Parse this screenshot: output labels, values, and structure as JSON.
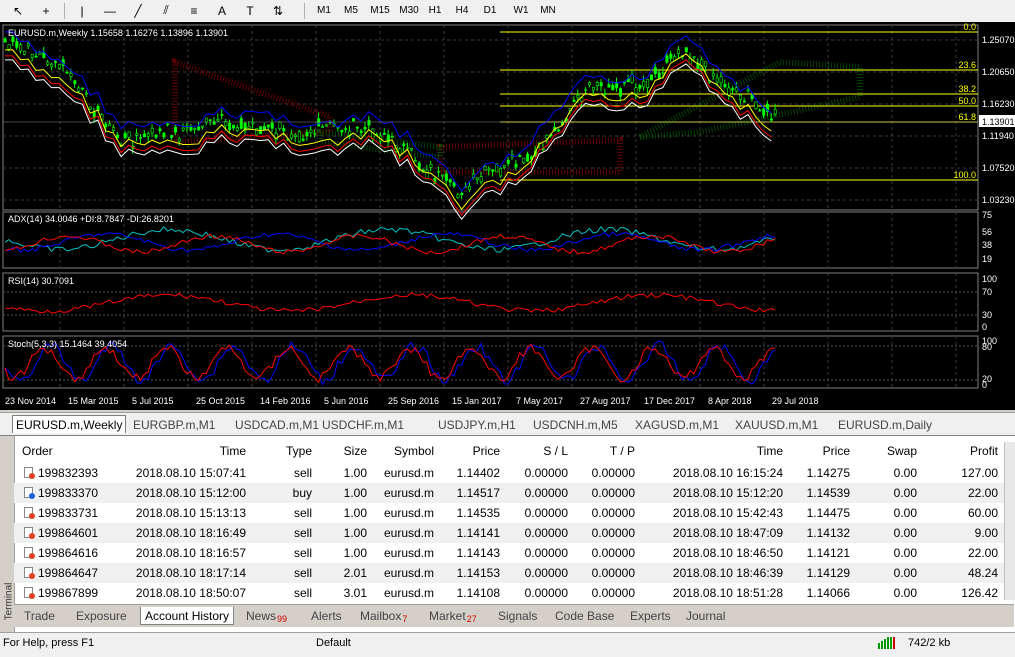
{
  "toolbar": {
    "timeframes": [
      "M1",
      "M5",
      "M15",
      "M30",
      "H1",
      "H4",
      "D1",
      "W1",
      "MN"
    ]
  },
  "chart": {
    "header": "EURUSD.m,Weekly  1.15658 1.16276 1.13896 1.13901",
    "price_labels": [
      "1.25070",
      "1.20650",
      "1.16230",
      "1.13901",
      "1.11940",
      "1.07520",
      "1.03230"
    ],
    "fib_levels": [
      "0.0",
      "23.6",
      "38.2",
      "50.0",
      "61.8",
      "100.0"
    ],
    "adx_label": "ADX(14) 34.0046 +DI:8.7847 -DI:26.8201",
    "adx_scale": [
      "75",
      "56",
      "38",
      "19"
    ],
    "rsi_label": "RSI(14) 30.7091",
    "rsi_scale": [
      "100",
      "70",
      "30",
      "0"
    ],
    "stoch_label": "Stoch(5,3,3) 15.1464 39.4054",
    "stoch_scale": [
      "100",
      "80",
      "20",
      "0"
    ],
    "dates": [
      "23 Nov 2014",
      "15 Mar 2015",
      "5 Jul 2015",
      "25 Oct 2015",
      "14 Feb 2016",
      "5 Jun 2016",
      "25 Sep 2016",
      "15 Jan 2017",
      "7 May 2017",
      "27 Aug 2017",
      "17 Dec 2017",
      "8 Apr 2018",
      "29 Jul 2018"
    ]
  },
  "chart_tabs": [
    "EURUSD.m,Weekly",
    "EURGBP.m,M1",
    "USDCAD.m,M1",
    "USDCHF.m,M1",
    "USDJPY.m,H1",
    "USDCNH.m,M5",
    "XAGUSD.m,M1",
    "XAUUSD.m,M1",
    "EURUSD.m,Daily"
  ],
  "terminal": {
    "side_label": "Terminal",
    "columns": [
      "Order",
      "Time",
      "Type",
      "Size",
      "Symbol",
      "Price",
      "S / L",
      "T / P",
      "Time",
      "Price",
      "Swap",
      "Profit"
    ],
    "rows": [
      {
        "order": "199832393",
        "open_time": "2018.08.10 15:07:41",
        "type": "sell",
        "size": "1.00",
        "symbol": "eurusd.m",
        "price": "1.14402",
        "sl": "0.00000",
        "tp": "0.00000",
        "close_time": "2018.08.10 16:15:24",
        "close_price": "1.14275",
        "swap": "0.00",
        "profit": "127.00"
      },
      {
        "order": "199833370",
        "open_time": "2018.08.10 15:12:00",
        "type": "buy",
        "size": "1.00",
        "symbol": "eurusd.m",
        "price": "1.14517",
        "sl": "0.00000",
        "tp": "0.00000",
        "close_time": "2018.08.10 15:12:20",
        "close_price": "1.14539",
        "swap": "0.00",
        "profit": "22.00"
      },
      {
        "order": "199833731",
        "open_time": "2018.08.10 15:13:13",
        "type": "sell",
        "size": "1.00",
        "symbol": "eurusd.m",
        "price": "1.14535",
        "sl": "0.00000",
        "tp": "0.00000",
        "close_time": "2018.08.10 15:42:43",
        "close_price": "1.14475",
        "swap": "0.00",
        "profit": "60.00"
      },
      {
        "order": "199864601",
        "open_time": "2018.08.10 18:16:49",
        "type": "sell",
        "size": "1.00",
        "symbol": "eurusd.m",
        "price": "1.14141",
        "sl": "0.00000",
        "tp": "0.00000",
        "close_time": "2018.08.10 18:47:09",
        "close_price": "1.14132",
        "swap": "0.00",
        "profit": "9.00"
      },
      {
        "order": "199864616",
        "open_time": "2018.08.10 18:16:57",
        "type": "sell",
        "size": "1.00",
        "symbol": "eurusd.m",
        "price": "1.14143",
        "sl": "0.00000",
        "tp": "0.00000",
        "close_time": "2018.08.10 18:46:50",
        "close_price": "1.14121",
        "swap": "0.00",
        "profit": "22.00"
      },
      {
        "order": "199864647",
        "open_time": "2018.08.10 18:17:14",
        "type": "sell",
        "size": "2.01",
        "symbol": "eurusd.m",
        "price": "1.14153",
        "sl": "0.00000",
        "tp": "0.00000",
        "close_time": "2018.08.10 18:46:39",
        "close_price": "1.14129",
        "swap": "0.00",
        "profit": "48.24"
      },
      {
        "order": "199867899",
        "open_time": "2018.08.10 18:50:07",
        "type": "sell",
        "size": "3.01",
        "symbol": "eurusd.m",
        "price": "1.14108",
        "sl": "0.00000",
        "tp": "0.00000",
        "close_time": "2018.08.10 18:51:28",
        "close_price": "1.14066",
        "swap": "0.00",
        "profit": "126.42"
      }
    ],
    "tabs": [
      {
        "label": "Trade",
        "badge": ""
      },
      {
        "label": "Exposure",
        "badge": ""
      },
      {
        "label": "Account History",
        "badge": ""
      },
      {
        "label": "News",
        "badge": "99"
      },
      {
        "label": "Alerts",
        "badge": ""
      },
      {
        "label": "Mailbox",
        "badge": "7"
      },
      {
        "label": "Market",
        "badge": "27"
      },
      {
        "label": "Signals",
        "badge": ""
      },
      {
        "label": "Code Base",
        "badge": ""
      },
      {
        "label": "Experts",
        "badge": ""
      },
      {
        "label": "Journal",
        "badge": ""
      }
    ]
  },
  "status": {
    "help": "For Help, press F1",
    "profile": "Default",
    "traffic": "742/2 kb"
  },
  "colors": {
    "bull_candle": "#00ff00",
    "bear_candle": "#00ff00",
    "adx": "#00c0c0",
    "plus_di": "#0000ff",
    "minus_di": "#ff0000",
    "rsi": "#ff0000",
    "stoch_main": "#0000ff",
    "stoch_signal": "#ff0000",
    "fib": "#ffff00",
    "cloud_bull": "#006400",
    "cloud_bear": "#8b0000"
  }
}
